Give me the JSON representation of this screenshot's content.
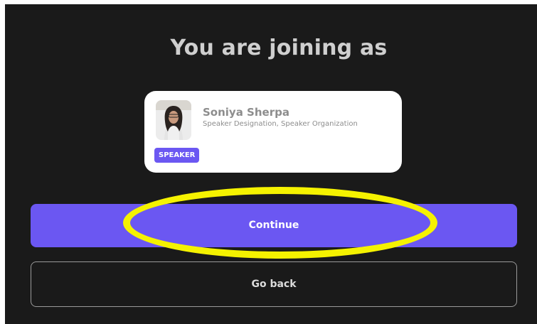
{
  "dialog": {
    "title": "You are joining as"
  },
  "profile": {
    "name": "Soniya Sherpa",
    "designation": "Speaker Designation, Speaker Organization",
    "role_badge": "SPEAKER",
    "avatar_icon": "user-avatar-photo"
  },
  "actions": {
    "continue_label": "Continue",
    "go_back_label": "Go back"
  },
  "colors": {
    "accent": "#6b57f2",
    "background": "#1a1a1a",
    "highlight": "#f5f200"
  }
}
